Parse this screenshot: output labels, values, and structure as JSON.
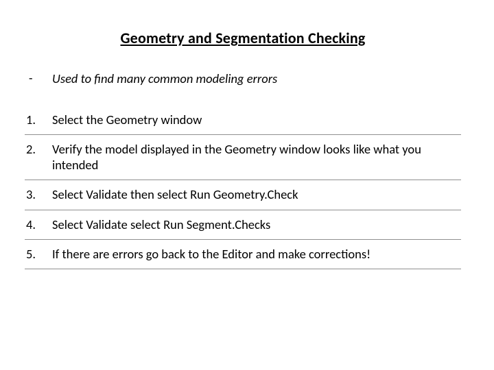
{
  "title": "Geometry and Segmentation Checking",
  "subtitle": {
    "bullet": "-",
    "text": "Used to find many common modeling errors"
  },
  "items": [
    {
      "num": "1.",
      "text": "Select the Geometry window"
    },
    {
      "num": "2.",
      "text": "Verify the model displayed in the Geometry window looks like what you intended"
    },
    {
      "num": "3.",
      "text": "Select Validate then select Run Geometry.Check"
    },
    {
      "num": "4.",
      "text": "Select Validate select Run Segment.Checks"
    },
    {
      "num": "5.",
      "text": "If there are errors go back to the Editor and make corrections!"
    }
  ]
}
